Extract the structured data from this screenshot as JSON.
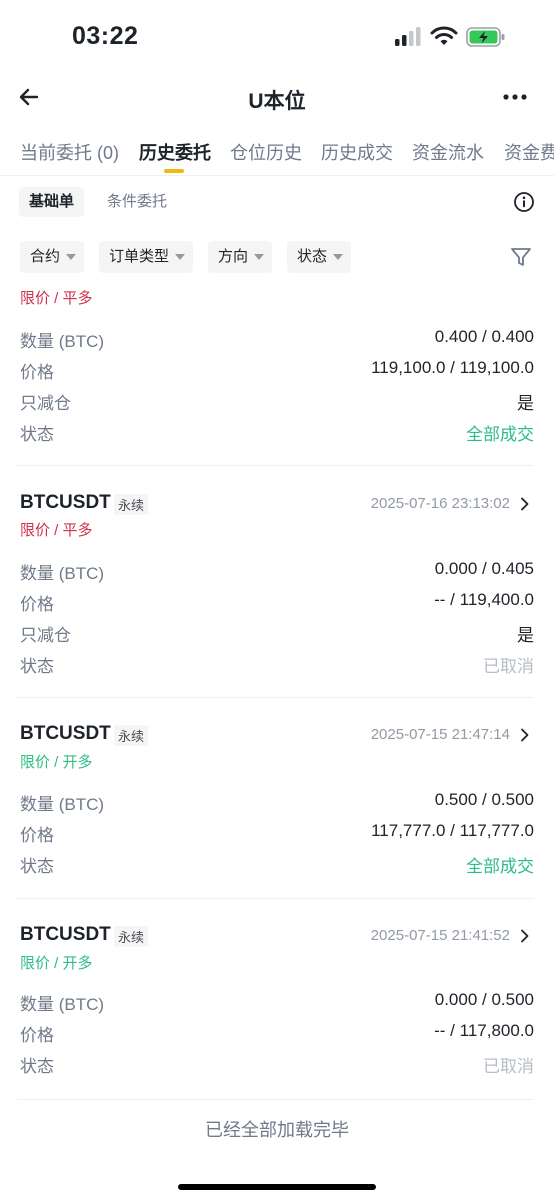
{
  "status_bar": {
    "time": "03:22"
  },
  "header": {
    "title": "U本位"
  },
  "tabs": [
    {
      "label": "当前委托 (0)"
    },
    {
      "label": "历史委托"
    },
    {
      "label": "仓位历史"
    },
    {
      "label": "历史成交"
    },
    {
      "label": "资金流水"
    },
    {
      "label": "资金费"
    }
  ],
  "subtabs": [
    {
      "label": "基础单"
    },
    {
      "label": "条件委托"
    }
  ],
  "filters": [
    {
      "label": "合约"
    },
    {
      "label": "订单类型"
    },
    {
      "label": "方向"
    },
    {
      "label": "状态"
    }
  ],
  "orders": [
    {
      "type": "限价 / 平多",
      "rows": [
        {
          "label": "数量 (BTC)",
          "value": "0.400 / 0.400"
        },
        {
          "label": "价格",
          "value": "119,100.0 / 119,100.0"
        },
        {
          "label": "只减仓",
          "value": "是"
        },
        {
          "label": "状态",
          "value": "全部成交"
        }
      ]
    },
    {
      "symbol": "BTCUSDT",
      "badge": "永续",
      "time": "2025-07-16 23:13:02",
      "type": "限价 / 平多",
      "rows": [
        {
          "label": "数量 (BTC)",
          "value": "0.000 / 0.405"
        },
        {
          "label": "价格",
          "value": "-- / 119,400.0"
        },
        {
          "label": "只减仓",
          "value": "是"
        },
        {
          "label": "状态",
          "value": "已取消"
        }
      ]
    },
    {
      "symbol": "BTCUSDT",
      "badge": "永续",
      "time": "2025-07-15 21:47:14",
      "type": "限价 / 开多",
      "rows": [
        {
          "label": "数量 (BTC)",
          "value": "0.500 / 0.500"
        },
        {
          "label": "价格",
          "value": "117,777.0 / 117,777.0"
        },
        {
          "label": "状态",
          "value": "全部成交"
        }
      ]
    },
    {
      "symbol": "BTCUSDT",
      "badge": "永续",
      "time": "2025-07-15 21:41:52",
      "type": "限价 / 开多",
      "rows": [
        {
          "label": "数量 (BTC)",
          "value": "0.000 / 0.500"
        },
        {
          "label": "价格",
          "value": "-- / 117,800.0"
        },
        {
          "label": "状态",
          "value": "已取消"
        }
      ]
    }
  ],
  "footer": {
    "text": "已经全部加载完毕"
  },
  "colors": {
    "accent": "#f0b90b",
    "sell": "#cf304a",
    "buy": "#2ebd85",
    "muted": "#707a8a",
    "cancelled": "#b7bdc6"
  },
  "icons": {
    "back": "arrow-left-icon",
    "more": "more-dots-icon",
    "info": "info-circle-icon",
    "filter": "funnel-icon",
    "chevron": "chevron-right-icon",
    "dropdown": "caret-down-icon"
  }
}
